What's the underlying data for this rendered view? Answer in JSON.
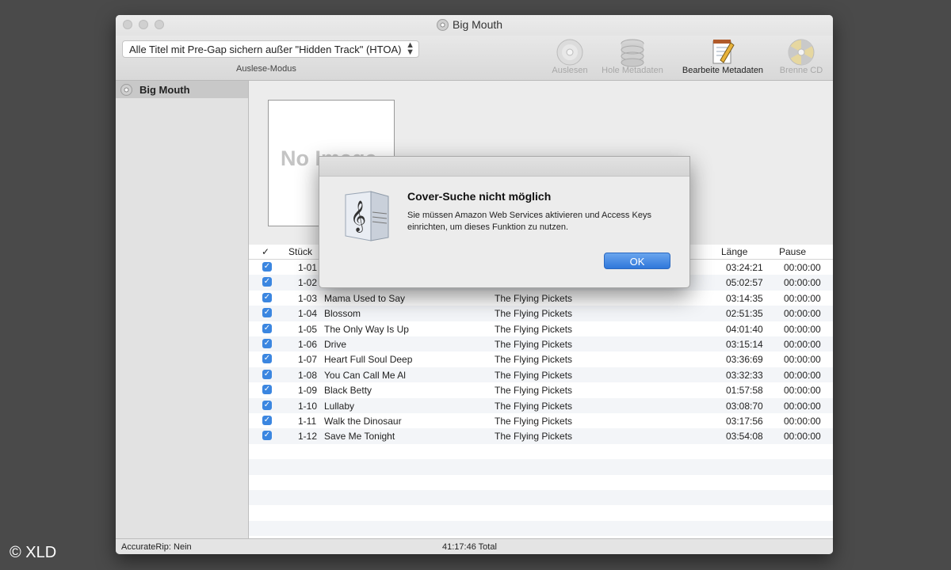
{
  "window": {
    "title": "Big Mouth"
  },
  "toolbar": {
    "mode_select": "Alle Titel mit Pre-Gap sichern außer \"Hidden Track\" (HTOA)",
    "mode_caption": "Auslese-Modus",
    "buttons": [
      {
        "label": "Auslesen",
        "icon": "cd-icon",
        "enabled": false
      },
      {
        "label": "Hole Metadaten",
        "icon": "database-icon",
        "enabled": false
      },
      {
        "label": "Bearbeite Metadaten",
        "icon": "notepad-pencil-icon",
        "enabled": true
      },
      {
        "label": "Brenne CD",
        "icon": "burn-cd-icon",
        "enabled": false
      }
    ]
  },
  "sidebar": {
    "items": [
      {
        "label": "Big Mouth",
        "icon": "cd-icon",
        "selected": true
      }
    ]
  },
  "cover": {
    "placeholder": "No Image"
  },
  "table": {
    "headers": {
      "check": "✓",
      "track": "Stück",
      "length": "Länge",
      "pause": "Pause"
    },
    "rows": [
      {
        "num": "1-01",
        "title": "",
        "artist": "",
        "length": "03:24:21",
        "pause": "00:00:00",
        "checked": true
      },
      {
        "num": "1-02",
        "title": "",
        "artist": "",
        "length": "05:02:57",
        "pause": "00:00:00",
        "checked": true
      },
      {
        "num": "1-03",
        "title": "Mama Used to Say",
        "artist": "The Flying Pickets",
        "length": "03:14:35",
        "pause": "00:00:00",
        "checked": true
      },
      {
        "num": "1-04",
        "title": "Blossom",
        "artist": "The Flying Pickets",
        "length": "02:51:35",
        "pause": "00:00:00",
        "checked": true
      },
      {
        "num": "1-05",
        "title": "The Only Way Is Up",
        "artist": "The Flying Pickets",
        "length": "04:01:40",
        "pause": "00:00:00",
        "checked": true
      },
      {
        "num": "1-06",
        "title": "Drive",
        "artist": "The Flying Pickets",
        "length": "03:15:14",
        "pause": "00:00:00",
        "checked": true
      },
      {
        "num": "1-07",
        "title": "Heart Full Soul Deep",
        "artist": "The Flying Pickets",
        "length": "03:36:69",
        "pause": "00:00:00",
        "checked": true
      },
      {
        "num": "1-08",
        "title": "You Can Call Me Al",
        "artist": "The Flying Pickets",
        "length": "03:32:33",
        "pause": "00:00:00",
        "checked": true
      },
      {
        "num": "1-09",
        "title": "Black Betty",
        "artist": "The Flying Pickets",
        "length": "01:57:58",
        "pause": "00:00:00",
        "checked": true
      },
      {
        "num": "1-10",
        "title": "Lullaby",
        "artist": "The Flying Pickets",
        "length": "03:08:70",
        "pause": "00:00:00",
        "checked": true
      },
      {
        "num": "1-11",
        "title": "Walk the Dinosaur",
        "artist": "The Flying Pickets",
        "length": "03:17:56",
        "pause": "00:00:00",
        "checked": true
      },
      {
        "num": "1-12",
        "title": "Save Me Tonight",
        "artist": "The Flying Pickets",
        "length": "03:54:08",
        "pause": "00:00:00",
        "checked": true
      }
    ]
  },
  "status": {
    "accuraterip": "AccurateRip: Nein",
    "total": "41:17:46 Total"
  },
  "dialog": {
    "title": "Cover-Suche nicht möglich",
    "message": "Sie müssen Amazon Web Services aktivieren und Access Keys einrichten, um dieses Funktion zu nutzen.",
    "ok_label": "OK"
  },
  "credit": "© XLD",
  "colors": {
    "accent": "#3b86e0",
    "background": "#4a4a4a"
  }
}
